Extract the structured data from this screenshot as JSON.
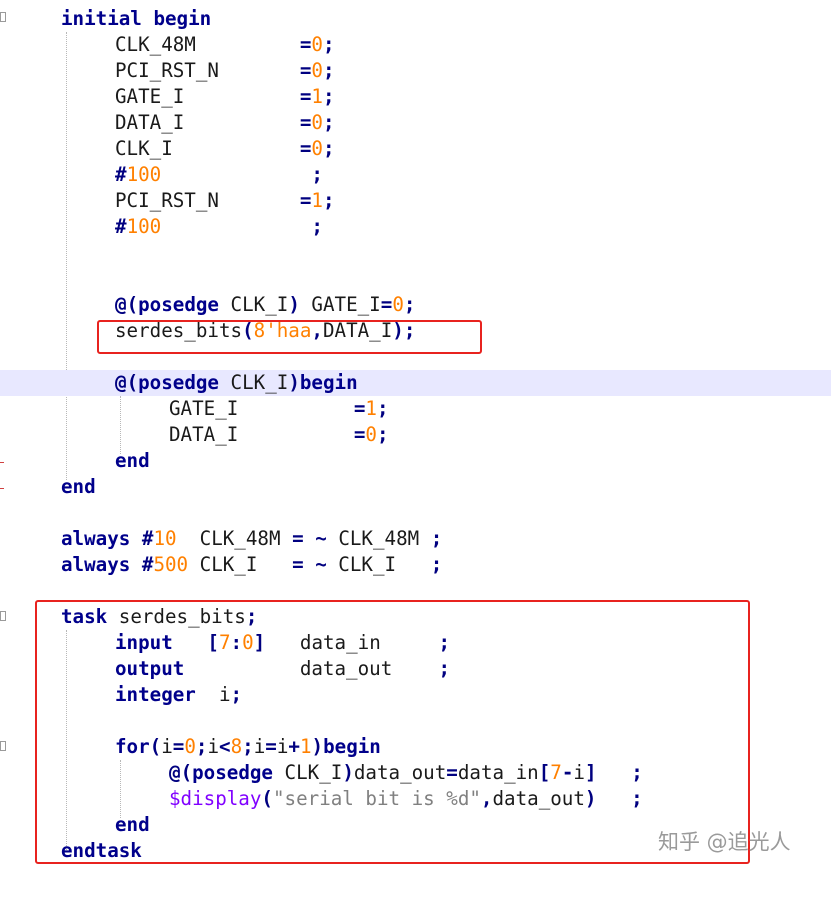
{
  "editor": {
    "line_1": "initial begin",
    "line_2": "CLK_48M         =0;",
    "line_3": "PCI_RST_N       =0;",
    "line_4": "GATE_I          =1;",
    "line_5": "DATA_I          =0;",
    "line_6": "CLK_I           =0;",
    "line_7": "#100             ;",
    "line_8": "PCI_RST_N       =1;",
    "line_9": "#100             ;",
    "line_12": "@(posedge CLK_I) GATE_I=0;",
    "line_13": "serdes_bits(8'haa,DATA_I);",
    "line_15": "@(posedge CLK_I)begin",
    "line_16": "GATE_I          =1;",
    "line_17": "DATA_I          =0;",
    "line_18": "end",
    "line_19": "end",
    "line_21": "always #10  CLK_48M = ~ CLK_48M ;",
    "line_22": "always #500 CLK_I   = ~ CLK_I   ;",
    "line_24": "task serdes_bits;",
    "line_25": "input   [7:0]   data_in     ;",
    "line_26": "output          data_out    ;",
    "line_27": "integer  i;",
    "line_29": "for(i=0;i<8;i=i+1)begin",
    "line_30": "@(posedge CLK_I)data_out=data_in[7-i]   ;",
    "line_31": "$display(\"serial bit is %d\",data_out)   ;",
    "line_32": "end",
    "line_33": "endtask"
  },
  "watermark": "知乎 @追光人",
  "colors": {
    "keyword": "#00008b",
    "number": "#ff8000",
    "string": "#808080",
    "system_task": "#8000ff",
    "current_line": "#e8e8ff",
    "annotation_box": "#e8231f"
  }
}
